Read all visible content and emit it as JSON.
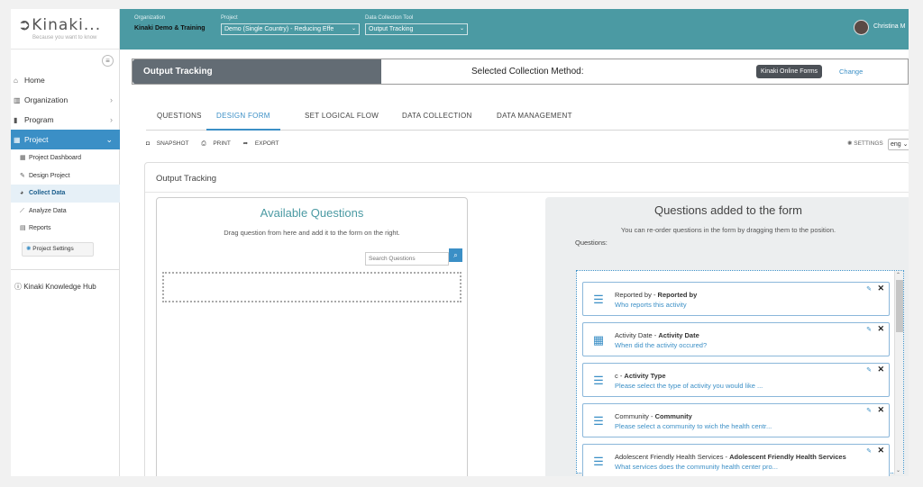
{
  "brand": {
    "logo": "Kinaki...",
    "tagline": "Because you want to know"
  },
  "sidebar": {
    "items": [
      {
        "label": "Home",
        "icon": "home-icon",
        "glyph": "⌂"
      },
      {
        "label": "Organization",
        "icon": "building-icon",
        "glyph": "▥"
      },
      {
        "label": "Program",
        "icon": "columns-icon",
        "glyph": "▮"
      },
      {
        "label": "Project",
        "icon": "dashboard-icon",
        "glyph": "▦"
      }
    ],
    "sub_items": [
      {
        "label": "Project Dashboard"
      },
      {
        "label": "Design Project"
      },
      {
        "label": "Collect Data"
      },
      {
        "label": "Analyze Data"
      },
      {
        "label": "Reports"
      }
    ],
    "project_settings": "Project Settings",
    "knowledge_hub": "Kinaki Knowledge Hub"
  },
  "header": {
    "organization_label": "Organization",
    "organization_value": "Kinaki Demo & Training",
    "project_label": "Project",
    "project_value": "Demo (Single Country) - Reducing Effe",
    "tool_label": "Data Collection Tool",
    "tool_value": "Output Tracking",
    "username": "Christina M"
  },
  "method_bar": {
    "title": "Output Tracking",
    "label": "Selected Collection Method:",
    "badge": "Kinaki Online Forms",
    "change": "Change"
  },
  "tabs": [
    {
      "label": "QUESTIONS"
    },
    {
      "label": "DESIGN FORM"
    },
    {
      "label": "SET LOGICAL FLOW"
    },
    {
      "label": "DATA COLLECTION"
    },
    {
      "label": "DATA MANAGEMENT"
    }
  ],
  "toolbar": {
    "snapshot": "SNAPSHOT",
    "print": "PRINT",
    "export": "EXPORT",
    "settings": "SETTINGS",
    "language": "eng"
  },
  "form": {
    "title": "Output Tracking",
    "available_title": "Available Questions",
    "available_hint": "Drag question from here and add it to the form on the right.",
    "search_placeholder": "Search Questions",
    "added_title": "Questions added to the form",
    "added_hint": "You can re-order questions in the form by dragging them to the position.",
    "questions_label": "Questions:"
  },
  "questions": [
    {
      "prefix": "Reported by - ",
      "name": "Reported by",
      "desc": "Who reports this activity",
      "icon": "list-icon"
    },
    {
      "prefix": "Activity Date - ",
      "name": "Activity Date",
      "desc": "When did the activity occured?",
      "icon": "calendar-icon"
    },
    {
      "prefix": "c - ",
      "name": "Activity Type",
      "desc": "Please select the type of activity you would like ...",
      "icon": "list-icon"
    },
    {
      "prefix": "Community - ",
      "name": "Community",
      "desc": "Please select a community to wich the health centr...",
      "icon": "list-icon"
    },
    {
      "prefix": "Adolescent Friendly Health Services - ",
      "name": "Adolescent Friendly Health Services",
      "desc": "What services does the community health center pro...",
      "icon": "list-icon"
    }
  ]
}
